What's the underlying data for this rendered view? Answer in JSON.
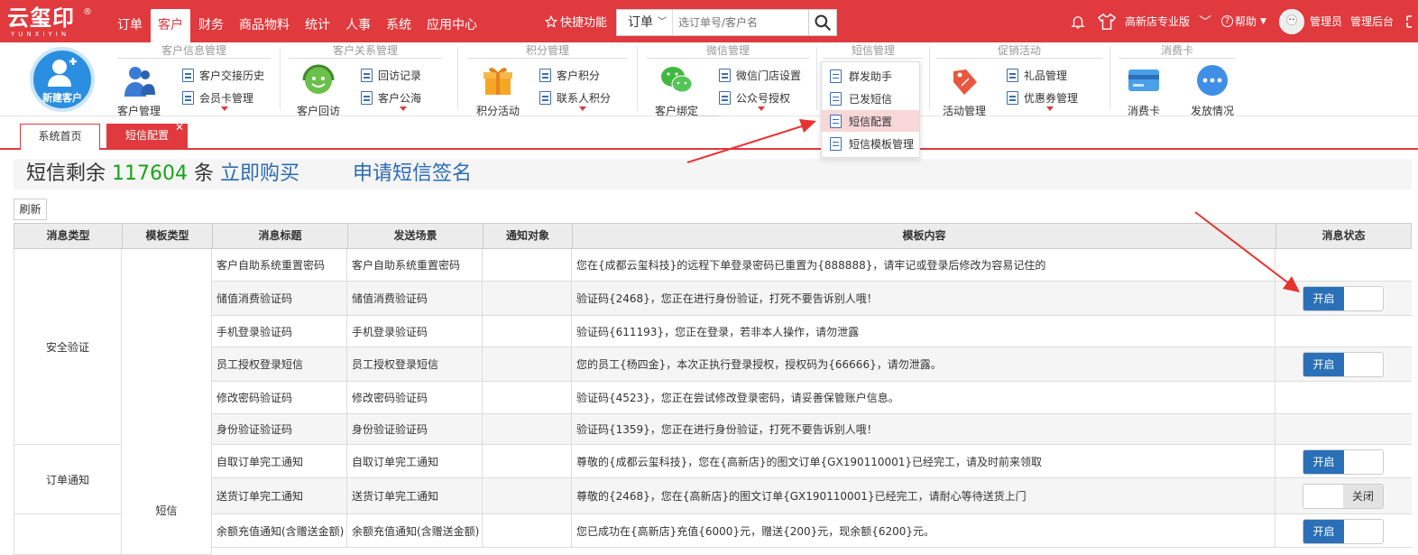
{
  "app": {
    "logo_text": "云玺印",
    "logo_sub": "YUNXIYIN",
    "logo_reg": "®"
  },
  "nav": [
    {
      "label": "订单",
      "active": false
    },
    {
      "label": "客户",
      "active": true
    },
    {
      "label": "财务",
      "active": false
    },
    {
      "label": "商品物料",
      "active": false
    },
    {
      "label": "统计",
      "active": false
    },
    {
      "label": "人事",
      "active": false
    },
    {
      "label": "系统",
      "active": false
    },
    {
      "label": "应用中心",
      "active": false
    }
  ],
  "quick": {
    "label": "快捷功能"
  },
  "search": {
    "type_label": "订单",
    "placeholder": "选订单号/客户名"
  },
  "top_right": {
    "store": "高新店专业版",
    "help": "帮助",
    "user": "管理员",
    "admin": "管理后台"
  },
  "ribbon": {
    "new_customer": "新建客户",
    "groups": [
      {
        "title": "客户信息管理",
        "big": "客户管理",
        "items": [
          "客户交接历史",
          "会员卡管理"
        ]
      },
      {
        "title": "客户关系管理",
        "big": "客户回访",
        "items": [
          "回访记录",
          "客户公海"
        ]
      },
      {
        "title": "积分管理",
        "big": "积分活动",
        "items": [
          "客户积分",
          "联系人积分"
        ]
      },
      {
        "title": "微信管理",
        "big": "客户绑定",
        "items": [
          "微信门店设置",
          "公众号授权"
        ]
      },
      {
        "title": "短信管理",
        "big": "",
        "items": [
          "群发助手",
          "已发短信"
        ]
      },
      {
        "title": "促销活动",
        "big": "活动管理",
        "items": [
          "礼品管理",
          "优惠券管理"
        ]
      },
      {
        "title": "消费卡",
        "big": "消费卡",
        "big2": "发放情况",
        "items": []
      }
    ],
    "dropdown": [
      "群发助手",
      "已发短信",
      "短信配置",
      "短信模板管理"
    ],
    "dropdown_active": 2
  },
  "tabs": [
    {
      "label": "系统首页"
    },
    {
      "label": "短信配置",
      "close": "✕"
    }
  ],
  "sms": {
    "prefix": "短信剩余",
    "count": "117604",
    "unit": "条",
    "buy": "立即购买",
    "sign": "申请短信签名"
  },
  "refresh_label": "刷新",
  "table": {
    "headers": [
      "消息类型",
      "模板类型",
      "消息标题",
      "发送场景",
      "通知对象",
      "模板内容",
      "消息状态"
    ],
    "rows": [
      {
        "title": "客户自助系统重置密码",
        "scene": "客户自助系统重置密码",
        "target": "",
        "content": "您在{成都云玺科技}的远程下单登录密码已重置为{888888}，请牢记或登录后修改为容易记住的",
        "status": ""
      },
      {
        "title": "储值消费验证码",
        "scene": "储值消费验证码",
        "target": "",
        "content": "验证码{2468}，您正在进行身份验证，打死不要告诉别人哦！",
        "status": "on"
      },
      {
        "title": "手机登录验证码",
        "scene": "手机登录验证码",
        "target": "",
        "content": "验证码{611193}，您正在登录，若非本人操作，请勿泄露",
        "status": ""
      },
      {
        "title": "员工授权登录短信",
        "scene": "员工授权登录短信",
        "target": "",
        "content": "您的员工{杨四金}，本次正执行登录授权，授权码为{66666}，请勿泄露。",
        "status": "on"
      },
      {
        "title": "修改密码验证码",
        "scene": "修改密码验证码",
        "target": "",
        "content": "验证码{4523}，您正在尝试修改登录密码，请妥善保管账户信息。",
        "status": ""
      },
      {
        "title": "身份验证验证码",
        "scene": "身份验证验证码",
        "target": "",
        "content": "验证码{1359}，您正在进行身份验证，打死不要告诉别人哦！",
        "status": ""
      },
      {
        "title": "自取订单完工通知",
        "scene": "自取订单完工通知",
        "target": "",
        "content": "尊敬的{成都云玺科技}，您在{高新店}的图文订单{GX190110001}已经完工，请及时前来领取",
        "status": "on"
      },
      {
        "title": "送货订单完工通知",
        "scene": "送货订单完工通知",
        "target": "",
        "content": "尊敬的{2468}，您在{高新店}的图文订单{GX190110001}已经完工，请耐心等待送货上门",
        "status": "off"
      },
      {
        "title": "余额充值通知(含赠送金额)",
        "scene": "余额充值通知(含赠送金额)",
        "target": "",
        "content": "您已成功在{高新店}充值{6000}元，赠送{200}元，现余额{6200}元。",
        "status": "on"
      }
    ],
    "groups": [
      {
        "label": "安全验证"
      },
      {
        "label": "订单通知"
      },
      {
        "label": ""
      }
    ],
    "template_type": "短信",
    "on_label": "开启",
    "off_label": "关闭"
  },
  "colors": {
    "brand": "#e0393e",
    "blue": "#2a70b8",
    "green": "#19a319"
  }
}
